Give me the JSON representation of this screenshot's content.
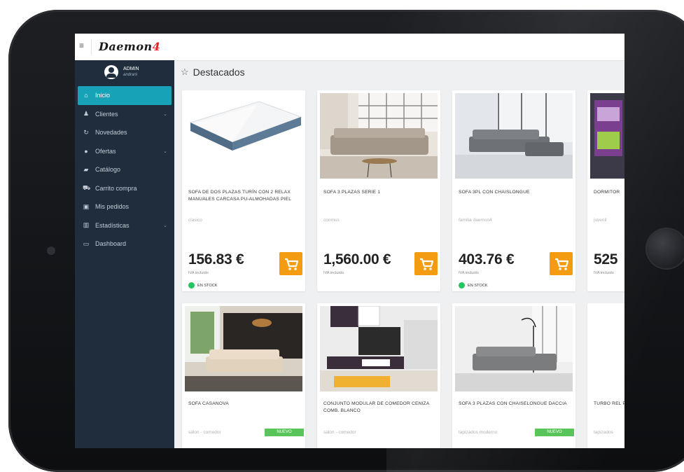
{
  "app": {
    "brand": "Daemon",
    "brand_accent": "4",
    "section_title": "Destacados"
  },
  "user": {
    "name": "ADMIN",
    "sub": "andrani"
  },
  "menu": [
    {
      "label": "Inicio",
      "icon": "home-icon",
      "active": true
    },
    {
      "label": "Clientes",
      "icon": "person-icon",
      "chevron": true
    },
    {
      "label": "Novedades",
      "icon": "refresh-icon"
    },
    {
      "label": "Ofertas",
      "icon": "circle-icon",
      "chevron": true
    },
    {
      "label": "Catálogo",
      "icon": "catalog-icon"
    },
    {
      "label": "Carrito compra",
      "icon": "cart-icon"
    },
    {
      "label": "Mis pedidos",
      "icon": "briefcase-icon"
    },
    {
      "label": "Estadísticas",
      "icon": "bar-chart-icon",
      "chevron": true
    },
    {
      "label": "Dashboard",
      "icon": "monitor-icon"
    }
  ],
  "products_row1": [
    {
      "title": "SOFA DE DOS PLAZAS TURÍN CON 2 RELAX MANUALES CARCASA PU-ALMOHADAS PIEL",
      "category": "clasico",
      "price": "156.83 €",
      "iva": "IVA incluido",
      "stock": "EN STOCK"
    },
    {
      "title": "SOFA 3 PLAZAS SERIE 1",
      "category": "conmus",
      "price": "1,560.00 €",
      "iva": "IVA incluido"
    },
    {
      "title": "SOFA 3PL CON CHAISLONGUE",
      "category": "familia daemon4",
      "price": "403.76 €",
      "iva": "IVA incluido",
      "stock": "EN STOCK"
    },
    {
      "title": "DORMITOR",
      "category": "juvenil",
      "price": "525",
      "iva": "IVA incluido"
    }
  ],
  "products_row2": [
    {
      "title": "SOFA CASANOVA",
      "category": "salon - comedor",
      "badge": "NUEVO"
    },
    {
      "title": "CONJUNTO MODULAR DE COMEDOR CENIZA COMB. BLANCO",
      "category": "salon - comedor"
    },
    {
      "title": "SOFA 3 PLAZAS CON CHAISELONGUE DACCIA",
      "category": "tapizados moderno",
      "badge": "NUEVO"
    },
    {
      "title": "TURBO REL PERLA (CON",
      "category": "tapizados"
    }
  ],
  "colors": {
    "sidebar": "#1f2d3d",
    "active": "#17a2b8",
    "cart_button": "#f39c12",
    "stock_dot": "#22c55e",
    "badge_new": "#58c45a",
    "brand_accent": "#e8232a"
  }
}
